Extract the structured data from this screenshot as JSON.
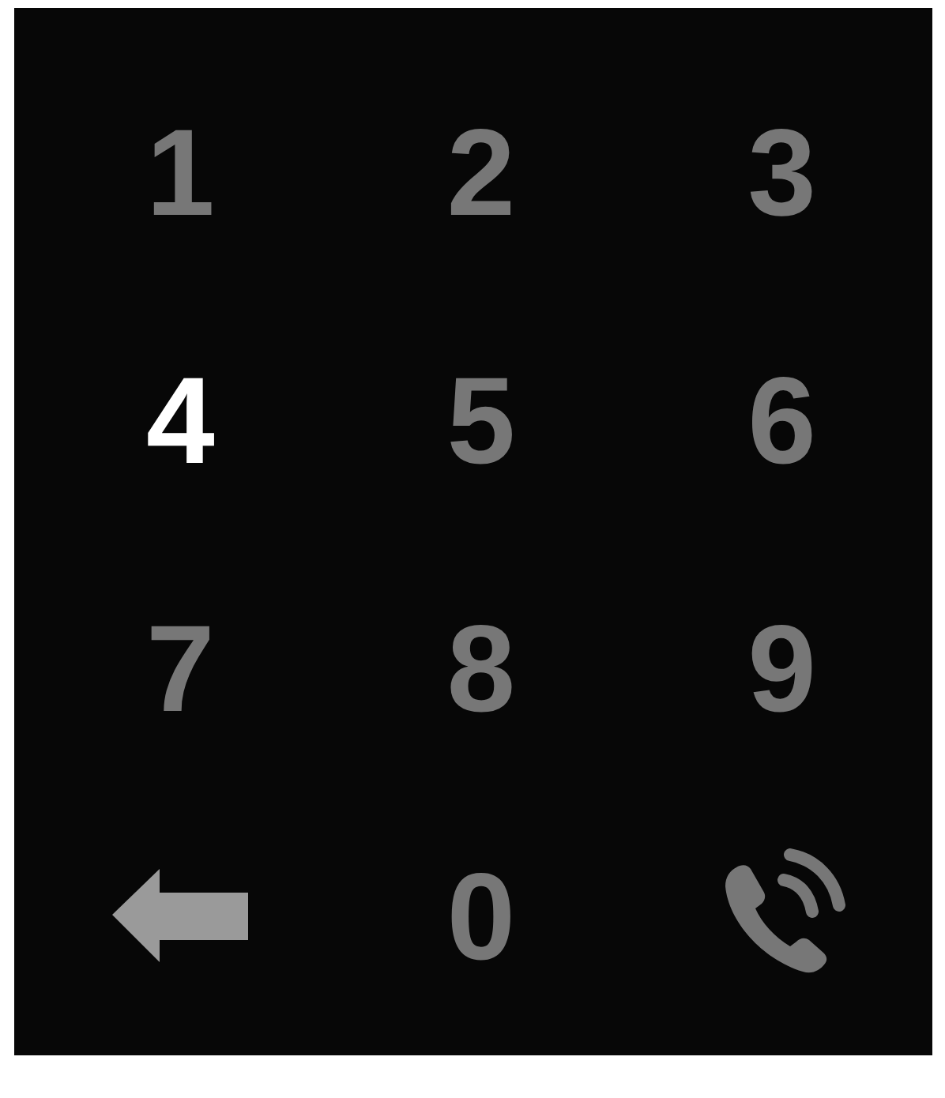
{
  "keys": [
    {
      "kind": "digit",
      "label": "1",
      "selected": false
    },
    {
      "kind": "digit",
      "label": "2",
      "selected": false
    },
    {
      "kind": "digit",
      "label": "3",
      "selected": false
    },
    {
      "kind": "digit",
      "label": "4",
      "selected": true
    },
    {
      "kind": "digit",
      "label": "5",
      "selected": false
    },
    {
      "kind": "digit",
      "label": "6",
      "selected": false
    },
    {
      "kind": "digit",
      "label": "7",
      "selected": false
    },
    {
      "kind": "digit",
      "label": "8",
      "selected": false
    },
    {
      "kind": "digit",
      "label": "9",
      "selected": false
    },
    {
      "kind": "backspace",
      "selected": false
    },
    {
      "kind": "digit",
      "label": "0",
      "selected": false
    },
    {
      "kind": "call",
      "selected": false
    }
  ]
}
